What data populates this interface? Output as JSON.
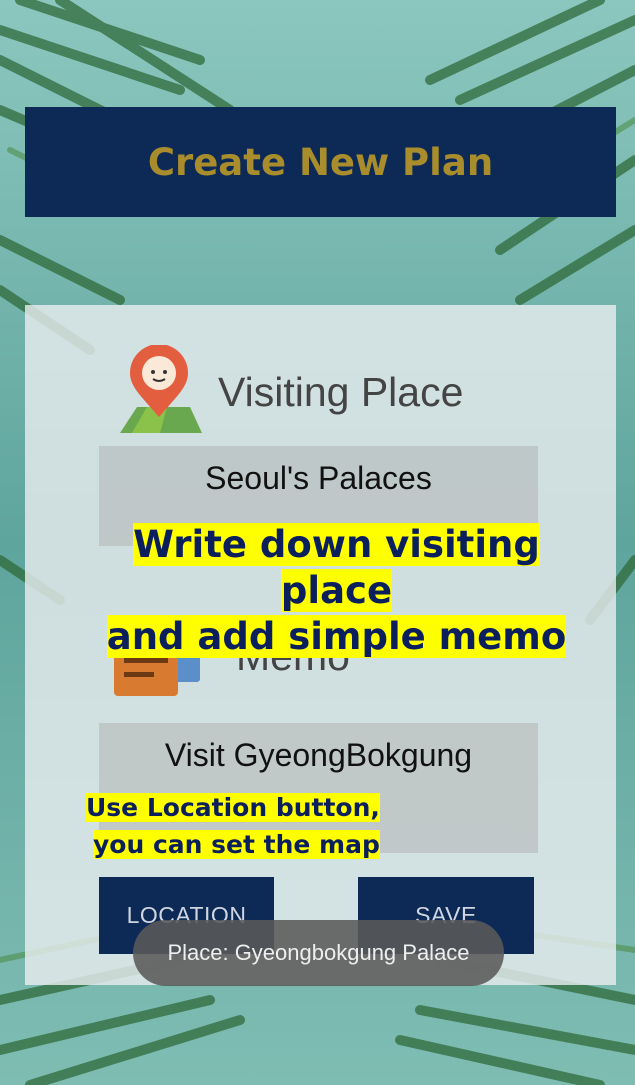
{
  "header": {
    "title": "Create New Plan"
  },
  "visiting_place": {
    "label": "Visiting Place",
    "value": "Seoul's Palaces"
  },
  "memo": {
    "label": "Memo",
    "value": "Visit GyeongBokgung"
  },
  "buttons": {
    "location": "LOCATION",
    "save": "SAVE"
  },
  "toast": {
    "text": "Place: Gyeongbokgung Palace"
  },
  "annotations": {
    "caption_line1": "Write down visiting place",
    "caption_line2": "and add simple memo",
    "hint_line1": "Use Location button,",
    "hint_line2": "you can set the map"
  },
  "colors": {
    "header_bg": "#0d2a57",
    "header_text": "#a98d2c",
    "button_bg": "#0d2a57",
    "highlight": "#ffff00"
  },
  "icons": {
    "place": "map-pin-icon",
    "memo": "notepad-icon"
  }
}
